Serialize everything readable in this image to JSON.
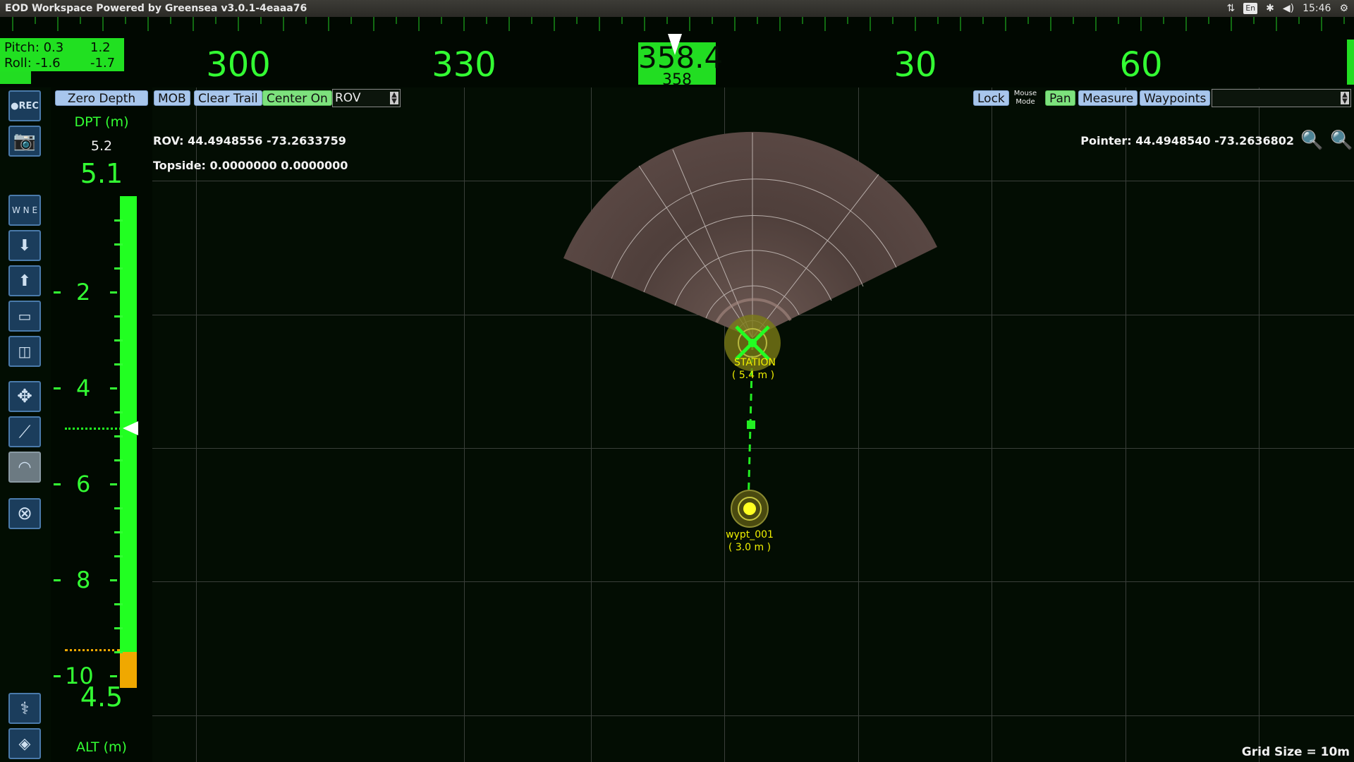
{
  "window": {
    "title": "EOD Workspace Powered by Greensea v3.0.1-4eaaa76",
    "tray_lang": "En",
    "time": "15:46"
  },
  "icons": {
    "network": "updown-arrows-icon",
    "bluetooth": "bluetooth-icon",
    "volume": "volume-icon",
    "settings": "gear-icon"
  },
  "heading": {
    "labels": [
      "300",
      "330",
      "30",
      "60"
    ],
    "current": "358.4",
    "setpoint": "358"
  },
  "attitude": {
    "pitch_label": "Pitch: 0.3",
    "pitch_set": "1.2",
    "roll_label": "Roll: -1.6",
    "roll_set": "-1.7"
  },
  "sidebar": {
    "buttons": [
      {
        "name": "record-button",
        "label": "●REC"
      },
      {
        "name": "camera-button",
        "label": ""
      },
      {
        "name": "heading-hold-button",
        "label": ""
      },
      {
        "name": "depth-hold-button",
        "label": ""
      },
      {
        "name": "surface-button",
        "label": ""
      },
      {
        "name": "vehicle-view-button",
        "label": ""
      },
      {
        "name": "vehicle-view-2-button",
        "label": ""
      },
      {
        "name": "move-button",
        "label": ""
      },
      {
        "name": "manipulator-button",
        "label": ""
      },
      {
        "name": "sonar-button",
        "label": ""
      },
      {
        "name": "thruster-button",
        "label": ""
      },
      {
        "name": "diagnostics-button",
        "label": ""
      },
      {
        "name": "altimeter-button",
        "label": ""
      }
    ]
  },
  "depth": {
    "title": "DPT (m)",
    "setpoint": "5.2",
    "current": "5.1",
    "scale": [
      "2",
      "4",
      "6",
      "8",
      "10"
    ],
    "altitude": "4.5",
    "alt_title": "ALT (m)",
    "depth_fraction": 0.51,
    "bar_color": "#22ff22",
    "seafloor_color": "#f0a800"
  },
  "toolbar": {
    "zero_depth": "Zero Depth",
    "mob": "MOB",
    "clear_trail": "Clear Trail",
    "center_on": "Center On",
    "center_target": "ROV",
    "lock": "Lock",
    "mouse_mode_1": "Mouse",
    "mouse_mode_2": "Mode",
    "pan": "Pan",
    "measure": "Measure",
    "waypoints": "Waypoints",
    "waypoint_select": ""
  },
  "map": {
    "rov_coord": "ROV: 44.4948556 -73.2633759",
    "topside_coord": "Topside: 0.0000000 0.0000000",
    "pointer_coord": "Pointer: 44.4948540 -73.2636802",
    "grid_size": "Grid Size = 10m",
    "station_label": "STATION",
    "station_dist": "( 5.4 m )",
    "waypoint_label": "wypt_001",
    "waypoint_dist": "( 3.0 m )",
    "zoom_out_icon": "zoom-out-icon",
    "zoom_in_icon": "zoom-in-icon"
  }
}
